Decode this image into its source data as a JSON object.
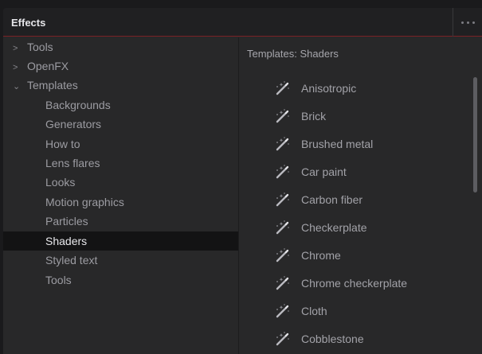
{
  "panel": {
    "title": "Effects"
  },
  "tree": {
    "items": [
      {
        "label": "Tools",
        "chevron": ">"
      },
      {
        "label": "OpenFX",
        "chevron": ">"
      },
      {
        "label": "Templates",
        "chevron": "⌄"
      },
      {
        "label": "Backgrounds"
      },
      {
        "label": "Generators"
      },
      {
        "label": "How to"
      },
      {
        "label": "Lens flares"
      },
      {
        "label": "Looks"
      },
      {
        "label": "Motion graphics"
      },
      {
        "label": "Particles"
      },
      {
        "label": "Shaders",
        "selected": true
      },
      {
        "label": "Styled text"
      },
      {
        "label": "Tools"
      }
    ]
  },
  "list": {
    "heading": "Templates: Shaders",
    "icon": "magic-wand-icon",
    "items": [
      "Anisotropic",
      "Brick",
      "Brushed metal",
      "Car paint",
      "Carbon fiber",
      "Checkerplate",
      "Chrome",
      "Chrome checkerplate",
      "Cloth",
      "Cobblestone"
    ]
  },
  "colors": {
    "accent_line": "#7a2226",
    "selected_bg": "#131314",
    "panel_bg": "#282829"
  }
}
